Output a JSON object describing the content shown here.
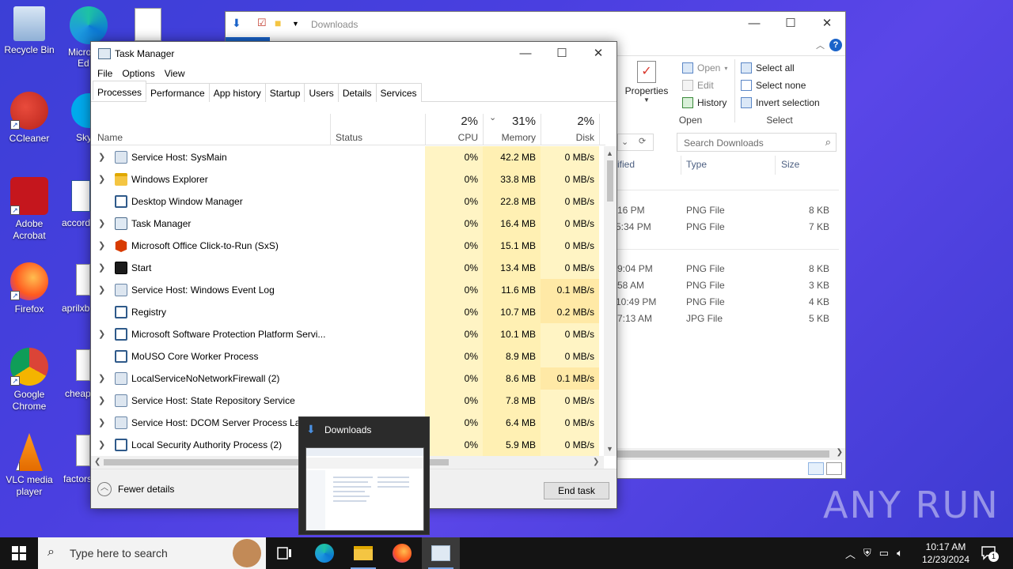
{
  "desktop": {
    "icons": [
      {
        "label": "Recycle Bin"
      },
      {
        "label": "CCleaner"
      },
      {
        "label": "Adobe Acrobat"
      },
      {
        "label": "Firefox"
      },
      {
        "label": "Google Chrome"
      },
      {
        "label": "VLC media player"
      }
    ],
    "partial_labels": [
      "Micro",
      "Ed",
      "Sky",
      "accord",
      "aprilxb",
      "cheapt",
      "factors"
    ]
  },
  "explorer": {
    "title": "Downloads",
    "ribbon": {
      "open_group": {
        "properties": "Properties",
        "open": "Open",
        "edit": "Edit",
        "history": "History",
        "label": "Open"
      },
      "select_group": {
        "select_all": "Select all",
        "select_none": "Select none",
        "invert_selection": "Invert selection",
        "label": "Select"
      }
    },
    "search_placeholder": "Search Downloads",
    "columns": {
      "modified": "ified",
      "type": "Type",
      "size": "Size"
    },
    "files": [
      {
        "date": "16 PM",
        "type": "PNG File",
        "size": "8 KB"
      },
      {
        "date": "5:34 PM",
        "type": "PNG File",
        "size": "7 KB"
      },
      {
        "date": "9:04 PM",
        "type": "PNG File",
        "size": "8 KB"
      },
      {
        "date": "58 AM",
        "type": "PNG File",
        "size": "3 KB"
      },
      {
        "date": "10:49 PM",
        "type": "PNG File",
        "size": "4 KB"
      },
      {
        "date": "7:13 AM",
        "type": "JPG File",
        "size": "5 KB"
      }
    ]
  },
  "task_manager": {
    "title": "Task Manager",
    "menu": [
      "File",
      "Options",
      "View"
    ],
    "tabs": [
      "Processes",
      "Performance",
      "App history",
      "Startup",
      "Users",
      "Details",
      "Services"
    ],
    "active_tab": "Processes",
    "headers": {
      "name": "Name",
      "status": "Status",
      "cpu_pct": "2%",
      "cpu": "CPU",
      "mem_pct": "31%",
      "mem": "Memory",
      "disk_pct": "2%",
      "disk": "Disk"
    },
    "processes": [
      {
        "name": "Service Host: SysMain",
        "expandable": true,
        "icon": "gear-icon",
        "cpu": "0%",
        "memory": "42.2 MB",
        "disk": "0 MB/s"
      },
      {
        "name": "Windows Explorer",
        "expandable": true,
        "icon": "folder-icon",
        "cpu": "0%",
        "memory": "33.8 MB",
        "disk": "0 MB/s"
      },
      {
        "name": "Desktop Window Manager",
        "expandable": false,
        "icon": "window-icon",
        "cpu": "0%",
        "memory": "22.8 MB",
        "disk": "0 MB/s"
      },
      {
        "name": "Task Manager",
        "expandable": true,
        "icon": "task-manager-icon",
        "cpu": "0%",
        "memory": "16.4 MB",
        "disk": "0 MB/s"
      },
      {
        "name": "Microsoft Office Click-to-Run (SxS)",
        "expandable": true,
        "icon": "office-icon",
        "cpu": "0%",
        "memory": "15.1 MB",
        "disk": "0 MB/s"
      },
      {
        "name": "Start",
        "expandable": true,
        "icon": "start-app-icon",
        "cpu": "0%",
        "memory": "13.4 MB",
        "disk": "0 MB/s"
      },
      {
        "name": "Service Host: Windows Event Log",
        "expandable": true,
        "icon": "gear-icon",
        "cpu": "0%",
        "memory": "11.6 MB",
        "disk": "0.1 MB/s"
      },
      {
        "name": "Registry",
        "expandable": false,
        "icon": "window-icon",
        "cpu": "0%",
        "memory": "10.7 MB",
        "disk": "0.2 MB/s"
      },
      {
        "name": "Microsoft Software Protection Platform Servi...",
        "expandable": true,
        "icon": "window-icon",
        "cpu": "0%",
        "memory": "10.1 MB",
        "disk": "0 MB/s"
      },
      {
        "name": "MoUSO Core Worker Process",
        "expandable": false,
        "icon": "window-icon",
        "cpu": "0%",
        "memory": "8.9 MB",
        "disk": "0 MB/s"
      },
      {
        "name": "LocalServiceNoNetworkFirewall (2)",
        "expandable": true,
        "icon": "gear-icon",
        "cpu": "0%",
        "memory": "8.6 MB",
        "disk": "0.1 MB/s"
      },
      {
        "name": "Service Host: State Repository Service",
        "expandable": true,
        "icon": "gear-icon",
        "cpu": "0%",
        "memory": "7.8 MB",
        "disk": "0 MB/s"
      },
      {
        "name": "Service Host: DCOM Server Process Launche...",
        "expandable": true,
        "icon": "gear-icon",
        "cpu": "0%",
        "memory": "6.4 MB",
        "disk": "0 MB/s"
      },
      {
        "name": "Local Security Authority Process (2)",
        "expandable": true,
        "icon": "window-icon",
        "cpu": "0%",
        "memory": "5.9 MB",
        "disk": "0 MB/s"
      }
    ],
    "footer": {
      "fewer_details": "Fewer details",
      "end_task": "End task"
    }
  },
  "preview": {
    "title": "Downloads"
  },
  "watermark": "ANY RUN",
  "taskbar": {
    "search_placeholder": "Type here to search",
    "time": "10:17 AM",
    "date": "12/23/2024",
    "notification_count": "1"
  }
}
